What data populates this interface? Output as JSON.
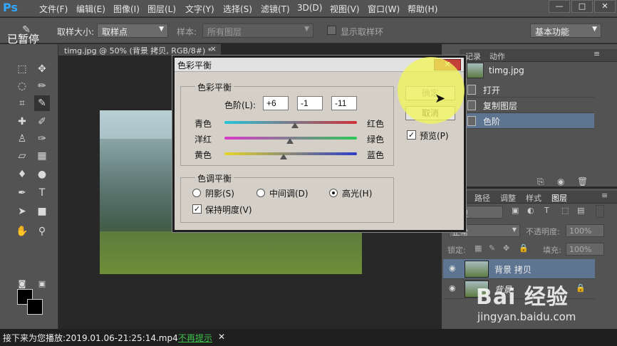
{
  "menubar": {
    "logo": "Ps",
    "items": [
      "文件(F)",
      "编辑(E)",
      "图像(I)",
      "图层(L)",
      "文字(Y)",
      "选择(S)",
      "滤镜(T)",
      "3D(D)",
      "视图(V)",
      "窗口(W)",
      "帮助(H)"
    ],
    "window_controls": [
      "—",
      "□",
      "✕"
    ]
  },
  "options": {
    "sample_size_label": "取样大小:",
    "sample_size_value": "取样点",
    "sample_label": "样本:",
    "sample_value": "所有图层",
    "show_ring_label": "显示取样环",
    "workspace": "基本功能"
  },
  "overlay": {
    "paused": "已暂停"
  },
  "document": {
    "tab_title": "timg.jpg @ 50% (背景 拷贝, RGB/8#) *",
    "tab_close": "×"
  },
  "history_panel": {
    "tabs": [
      "记录",
      "动作"
    ],
    "snapshot": "timg.jpg",
    "items": [
      {
        "label": "打开",
        "selected": false
      },
      {
        "label": "复制图层",
        "selected": false
      },
      {
        "label": "色阶",
        "selected": true
      }
    ]
  },
  "layers_panel": {
    "tabs": [
      "路径",
      "调整",
      "样式",
      "图层"
    ],
    "filter_kind": "类型",
    "blend_mode": "正常",
    "opacity_label": "不透明度:",
    "opacity_value": "100%",
    "lock_label": "锁定:",
    "fill_label": "填充:",
    "fill_value": "100%",
    "layers": [
      {
        "name": "背景 拷贝",
        "selected": true
      },
      {
        "name": "背景",
        "selected": false
      }
    ]
  },
  "dialog": {
    "title": "色彩平衡",
    "color_balance_group": "色彩平衡",
    "levels_label": "色阶(L):",
    "levels": [
      "+6",
      "-1",
      "-11"
    ],
    "sliders": [
      {
        "left": "青色",
        "right": "红色",
        "value": 6
      },
      {
        "left": "洋红",
        "right": "绿色",
        "value": -1
      },
      {
        "left": "黄色",
        "right": "蓝色",
        "value": -11
      }
    ],
    "tone_group": "色调平衡",
    "tones": [
      {
        "label": "阴影(S)",
        "selected": false
      },
      {
        "label": "中间调(D)",
        "selected": false
      },
      {
        "label": "高光(H)",
        "selected": true
      }
    ],
    "preserve_luminosity": "保持明度(V)",
    "ok": "确定",
    "cancel": "取消",
    "preview": "预览(P)"
  },
  "bottom_bar": {
    "text": "接下来为您播放:2019.01.06-21:25:14.mp4",
    "dismiss": "不再提示",
    "close": "✕"
  },
  "watermark": {
    "brand": "Bai 经验",
    "url": "jingyan.baidu.com"
  },
  "colors": {
    "accent_selection": "#5d7591",
    "ps_blue": "#31a8ff",
    "dialog_bg": "#d4d0c8",
    "highlight": "#f0f55a"
  }
}
